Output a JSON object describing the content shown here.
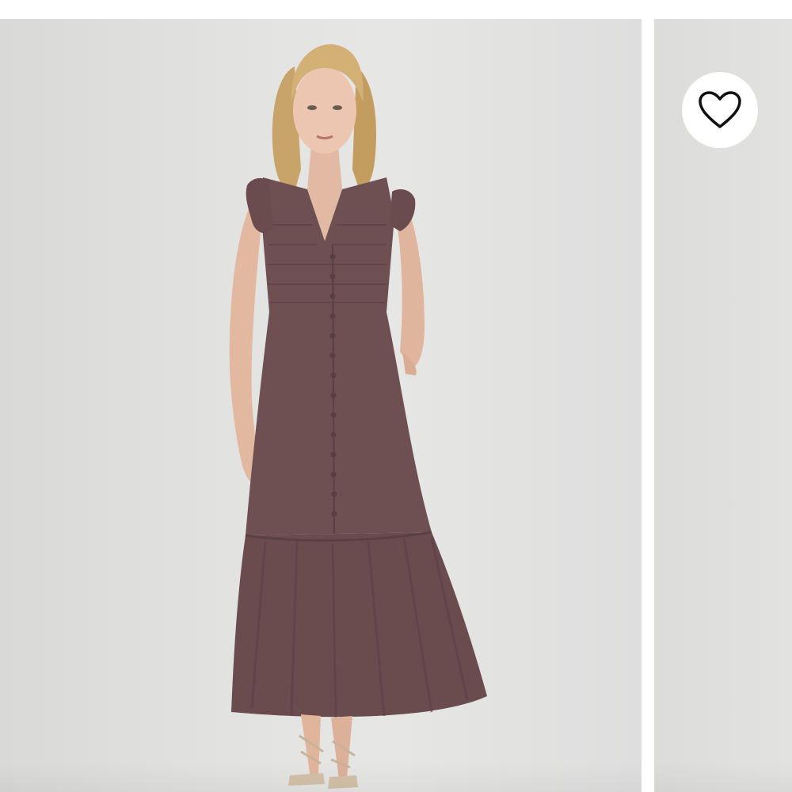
{
  "product_gallery": {
    "current_image": {
      "subject": "model-in-dress"
    },
    "favorite_button": {
      "icon": "heart-outline-icon",
      "icon_color": "#111111",
      "background_color": "#ffffff"
    },
    "colors": {
      "dress": "#6e4f52",
      "dress_dark": "#5b4043",
      "backdrop": "#e3e3e1"
    }
  }
}
